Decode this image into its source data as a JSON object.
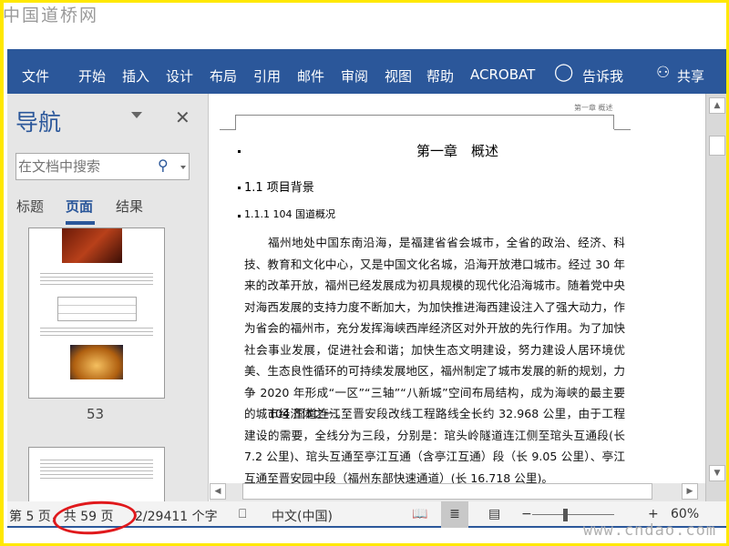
{
  "watermark_top": "中国道桥网",
  "watermark_bottom": "www.cndao.com",
  "colors": {
    "ribbon": "#2b579a",
    "frame": "#ffe800",
    "annotation_circle": "#e0191c"
  },
  "ribbon": {
    "tabs": [
      "文件",
      "开始",
      "插入",
      "设计",
      "布局",
      "引用",
      "邮件",
      "审阅",
      "视图",
      "帮助",
      "ACROBAT"
    ],
    "tell_me": "告诉我",
    "share": "共享"
  },
  "nav": {
    "title": "导航",
    "search_placeholder": "在文档中搜索",
    "tabs": [
      "标题",
      "页面",
      "结果"
    ],
    "active_tab": "页面",
    "page_label": "53"
  },
  "doc": {
    "header": "第一章  概述",
    "h1": "第一章　概述",
    "h2": "1.1  项目背景",
    "h3": "1.1.1  104 国道概况",
    "p1": "福州地处中国东南沿海，是福建省省会城市，全省的政治、经济、科技、教育和文化中心，又是中国文化名城，沿海开放港口城市。经过 30 年来的改革开放，福州已经发展成为初具规模的现代化沿海城市。随着党中央对海西发展的支持力度不断加大，为加快推进海西建设注入了强大动力，作为省会的福州市，充分发挥海峡西岸经济区对外开放的先行作用。为了加快社会事业发展，促进社会和谐；加快生态文明建设，努力建设人居环境优美、生态良性循环的可持续发展地区，福州制定了城市发展的新的规划，力争 2020 年形成“一区”“三轴”“八新城”空间布局结构，成为海峡的最主要的城市经济体之一。",
    "p2": "104 国道连江至晋安段改线工程路线全长约 32.968 公里，由于工程建设的需要，全线分为三段，分别是：琯头岭隧道连江侧至琯头互通段(长 7.2 公里)、琯头互通至亭江互通（含亭江互通）段（长 9.05 公里）、亭江互通至晋安园中段（福州东部快速通道）(长 16.718 公里)。"
  },
  "status": {
    "page": "第 5 页，共 59 页",
    "words": "2/29411 个字",
    "language": "中文(中国)",
    "zoom": "60%",
    "zoom_value_percent": 60
  }
}
